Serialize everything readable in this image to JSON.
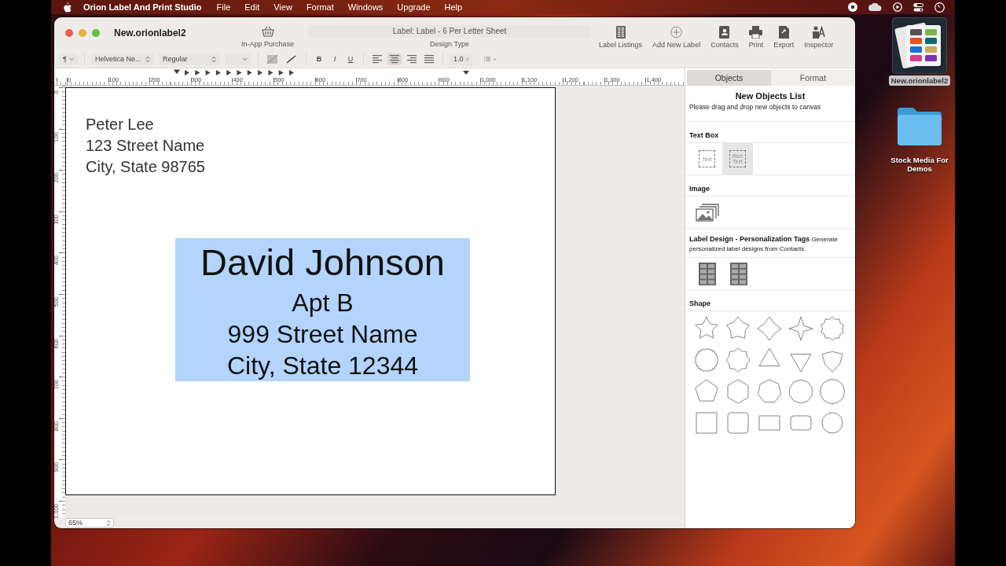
{
  "menubar": {
    "app_name": "Orion Label And Print Studio",
    "items": [
      "File",
      "Edit",
      "View",
      "Format",
      "Windows",
      "Upgrade",
      "Help"
    ]
  },
  "window": {
    "title": "New.orionlabel2",
    "purchase_button": {
      "label": "In-App Purchase"
    },
    "design_type": {
      "value": "Label: Label - 6 Per Letter Sheet",
      "label": "Design Type"
    },
    "toolbar": [
      {
        "kind": "listings",
        "label": "Label Listings"
      },
      {
        "kind": "add",
        "label": "Add New Label"
      },
      {
        "kind": "contacts",
        "label": "Contacts"
      },
      {
        "kind": "print",
        "label": "Print"
      },
      {
        "kind": "export",
        "label": "Export"
      },
      {
        "kind": "inspector",
        "label": "Inspector"
      }
    ]
  },
  "format_bar": {
    "paragraph": "¶",
    "font": "Helvetica Ne...",
    "style": "Regular",
    "styles": [
      {
        "kind": "bold",
        "label": "B"
      },
      {
        "kind": "italic",
        "label": "I"
      },
      {
        "kind": "underline",
        "label": "U"
      }
    ],
    "alignments": [
      {
        "kind": "left",
        "selected": false
      },
      {
        "kind": "center",
        "selected": true
      },
      {
        "kind": "right",
        "selected": false
      },
      {
        "kind": "justify",
        "selected": false
      }
    ],
    "line_spacing": "1.0"
  },
  "ruler": {
    "horizontal": [
      "0",
      "100",
      "200",
      "300",
      "400",
      "500",
      "600",
      "700",
      "800",
      "900",
      "1,000",
      "1,100",
      "1,200",
      "1,300",
      "1,400"
    ],
    "vertical": [
      "0",
      "100",
      "200",
      "300",
      "400",
      "500",
      "600",
      "700",
      "800",
      "900",
      "1,000"
    ]
  },
  "canvas": {
    "return_address": [
      "Peter Lee",
      "123 Street Name",
      "City, State 98765"
    ],
    "recipient": {
      "selected": true,
      "lines": [
        "David Johnson",
        "Apt B",
        "999 Street Name",
        "City, State 12344"
      ]
    }
  },
  "zoom": "65%",
  "panel": {
    "tabs": [
      {
        "label": "Objects",
        "selected": true
      },
      {
        "label": "Format",
        "selected": false
      }
    ],
    "title": "New Objects List",
    "subtitle": "Please drag and drop new objects to canvas",
    "sections": [
      {
        "kind": "textbox",
        "heading": "Text Box",
        "items": [
          {
            "label": "Text",
            "selected": false
          },
          {
            "label": "Rich Text",
            "selected": true
          }
        ]
      },
      {
        "kind": "image",
        "heading": "Image"
      },
      {
        "kind": "tags",
        "description": "**Label Design - Personalization Tags** Generate personalized label designs from Contacts."
      },
      {
        "kind": "shape",
        "heading": "Shape"
      }
    ]
  },
  "desktop": [
    {
      "kind": "document",
      "label": "New.orionlabel2",
      "selected": true
    },
    {
      "kind": "folder",
      "label": "Stock Media For Demos",
      "selected": false
    }
  ]
}
